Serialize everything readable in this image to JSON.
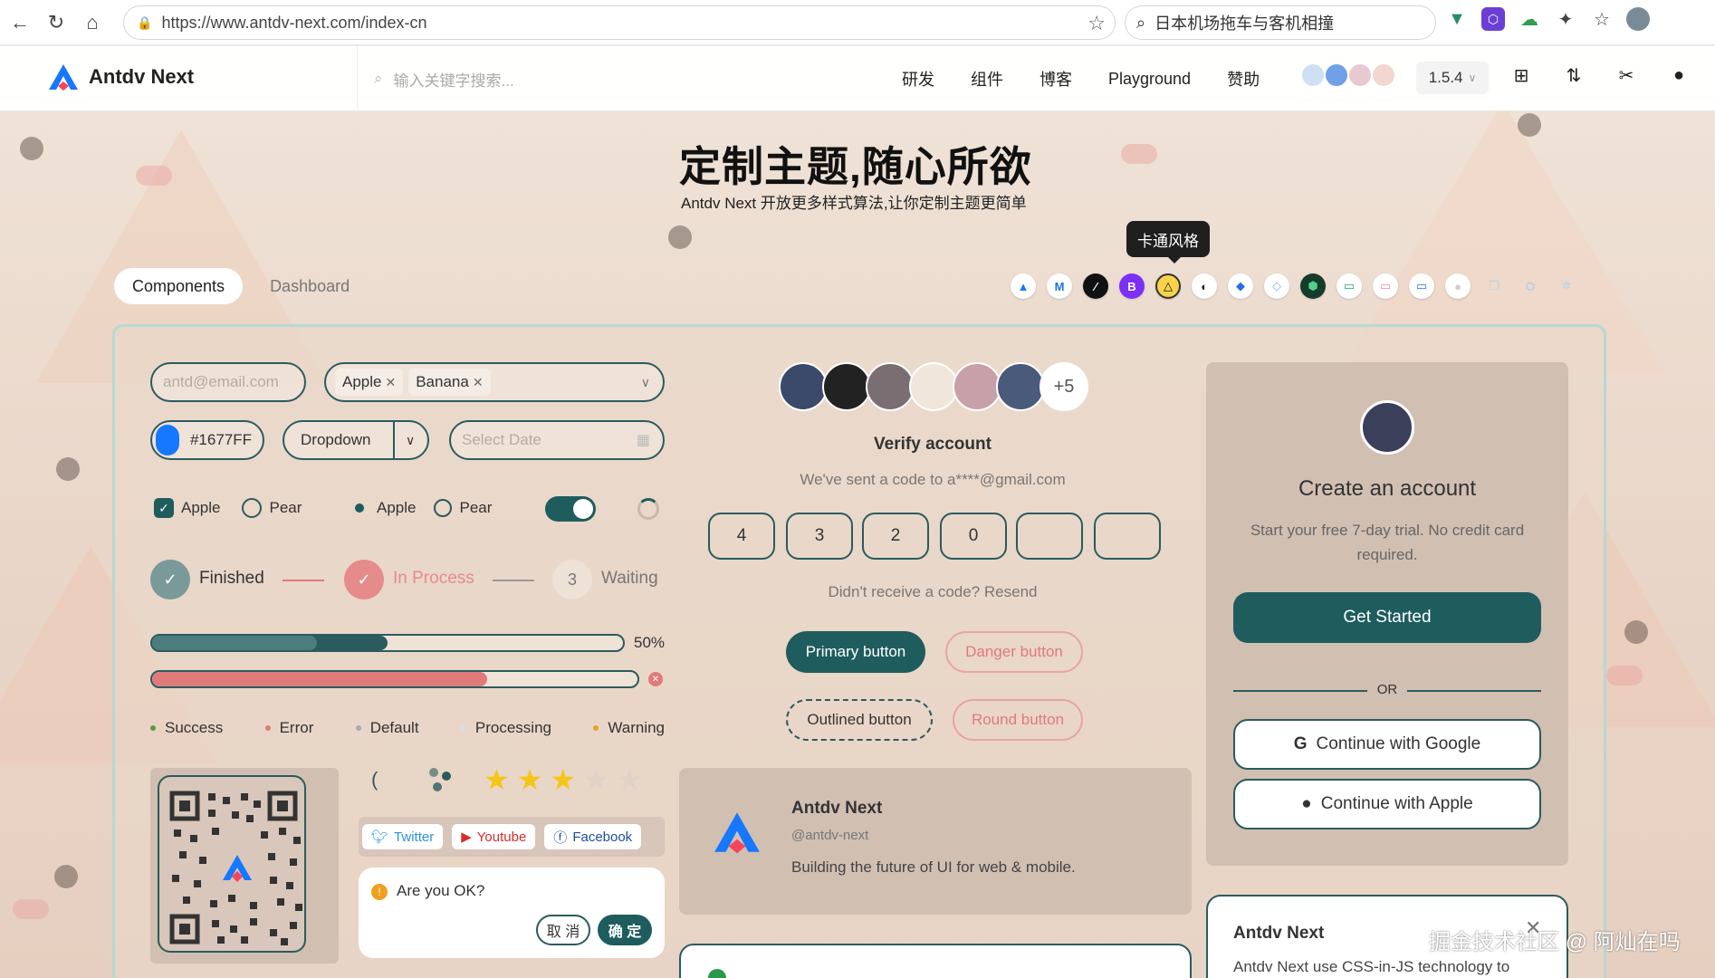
{
  "browser": {
    "url": "https://www.antdv-next.com/index-cn",
    "search_text": "日本机场拖车与客机相撞"
  },
  "header": {
    "logo_text": "Antdv Next",
    "search_placeholder": "输入关键字搜索...",
    "menu": [
      "研发",
      "组件",
      "博客",
      "Playground",
      "赞助"
    ],
    "version": "1.5.4"
  },
  "hero": {
    "title": "定制主题,随心所欲",
    "subtitle": "Antdv Next 开放更多样式算法,让你定制主题更简单"
  },
  "tabs": {
    "active": "Components",
    "other": "Dashboard"
  },
  "theme_tooltip": "卡通风格",
  "form": {
    "email_placeholder": "antd@email.com",
    "tags": [
      "Apple",
      "Banana"
    ],
    "color_value": "#1677FF",
    "dropdown_label": "Dropdown",
    "date_placeholder": "Select Date",
    "checkbox_options": [
      "Apple",
      "Pear"
    ],
    "radio_options": [
      "Apple",
      "Pear"
    ],
    "steps": [
      {
        "label": "Finished",
        "number": ""
      },
      {
        "label": "In Process",
        "number": ""
      },
      {
        "label": "Waiting",
        "number": "3"
      }
    ],
    "progress": {
      "percent_label": "50%",
      "value": 0.5,
      "inner_value": 0.35,
      "error_value": 0.69
    },
    "statuses": [
      "Success",
      "Error",
      "Default",
      "Processing",
      "Warning"
    ],
    "rating": {
      "value": 3,
      "max": 5
    },
    "social": [
      "Twitter",
      "Youtube",
      "Facebook"
    ],
    "popconfirm": {
      "text": "Are you OK?",
      "cancel": "取 消",
      "ok": "确 定"
    }
  },
  "verify": {
    "avatar_more": "+5",
    "title": "Verify account",
    "sent_text": "We've sent a code to a****@gmail.com",
    "code": [
      "4",
      "3",
      "2",
      "0",
      "",
      ""
    ],
    "resend_text": "Didn't receive a code? Resend",
    "buttons": {
      "primary": "Primary button",
      "danger": "Danger button",
      "outlined": "Outlined button",
      "round": "Round button"
    }
  },
  "profile_card": {
    "name": "Antdv Next",
    "handle": "@antdv-next",
    "bio": "Building the future of UI for web & mobile."
  },
  "signup": {
    "title": "Create an account",
    "subtitle": "Start your free 7-day trial. No credit card required.",
    "get_started": "Get Started",
    "or": "OR",
    "google": "Continue with Google",
    "apple": "Continue with Apple"
  },
  "notice_card": {
    "title": "Antdv Next",
    "text": "Antdv Next use CSS-in-JS technology to"
  },
  "watermark": "掘金技术社区 @ 阿灿在吗",
  "colors": {
    "primary": "#1f5c5e",
    "danger": "#e07a7a",
    "accent_blue": "#1677ff",
    "warning": "#f0a020"
  }
}
